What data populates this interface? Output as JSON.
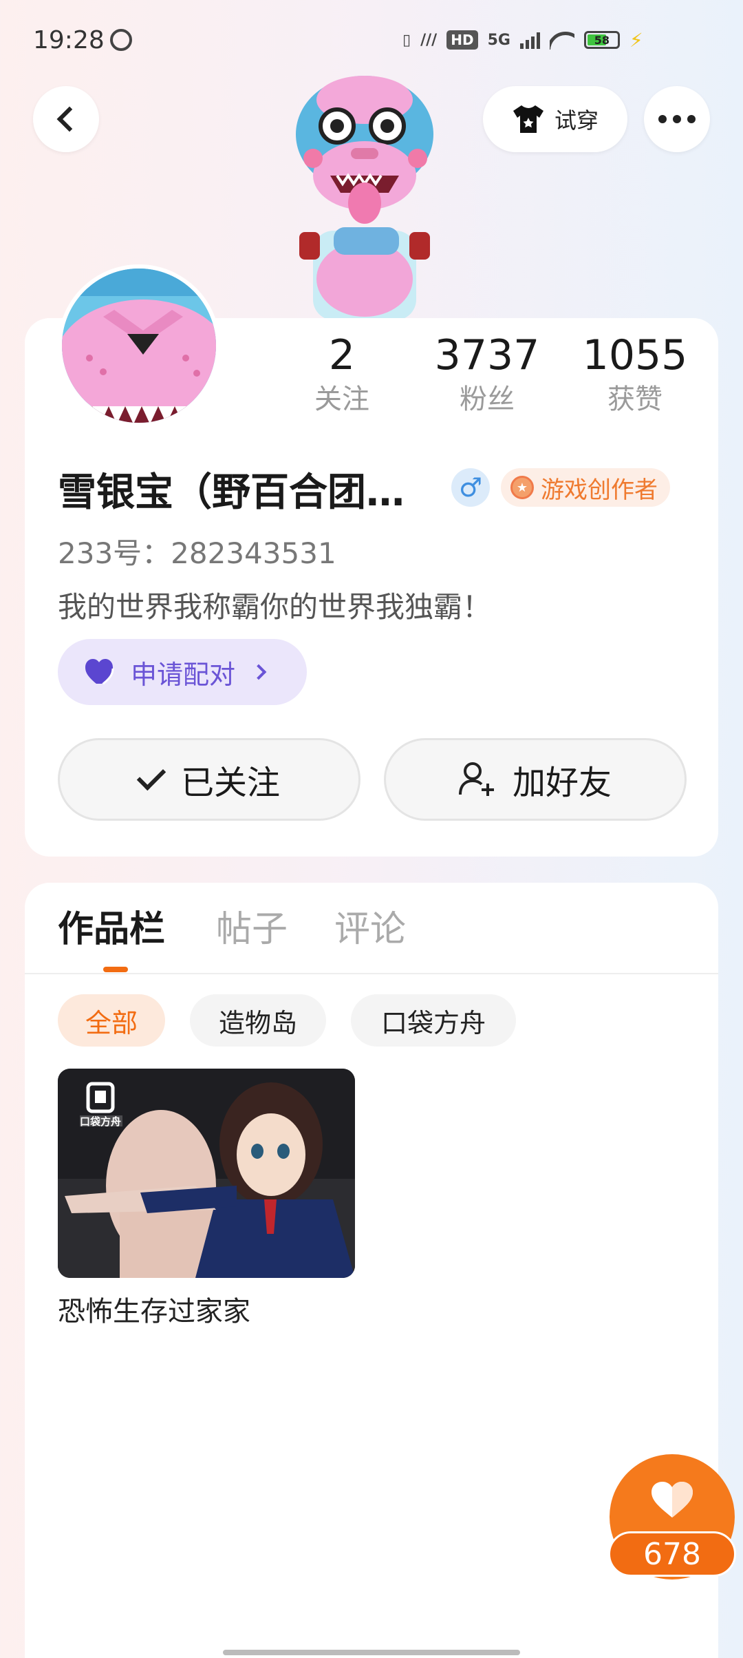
{
  "status_bar": {
    "time": "19:28",
    "network": "5G",
    "hd": "HD",
    "battery": "58"
  },
  "header": {
    "try_on_label": "试穿"
  },
  "profile": {
    "stats": [
      {
        "value": "2",
        "label": "关注"
      },
      {
        "value": "3737",
        "label": "粉丝"
      },
      {
        "value": "1055",
        "label": "获赞"
      }
    ],
    "nickname": "雪银宝（野百合团…",
    "gender_symbol": "♂",
    "creator_badge": "游戏创作者",
    "user_id": "233号：282343531",
    "bio": "我的世界我称霸你的世界我独霸！",
    "match_label": "申请配对",
    "follow_label": "已关注",
    "add_friend_label": "加好友"
  },
  "works": {
    "tabs": [
      {
        "label": "作品栏",
        "active": true
      },
      {
        "label": "帖子",
        "active": false
      },
      {
        "label": "评论",
        "active": false
      }
    ],
    "filters": [
      {
        "label": "全部",
        "active": true
      },
      {
        "label": "造物岛",
        "active": false
      },
      {
        "label": "口袋方舟",
        "active": false
      }
    ],
    "items": [
      {
        "title": "恐怖生存过家家",
        "thumb_logo": "口袋方舟"
      }
    ]
  },
  "like": {
    "count": "678"
  },
  "colors": {
    "accent": "#f26c12",
    "match_purple": "#6a54d6",
    "gender_blue": "#3f8fe0"
  },
  "icons": [
    "back-icon",
    "shirt-icon",
    "more-icon",
    "male-icon",
    "medal-icon",
    "heart-icon",
    "chevron-right-icon",
    "check-icon",
    "person-plus-icon"
  ]
}
